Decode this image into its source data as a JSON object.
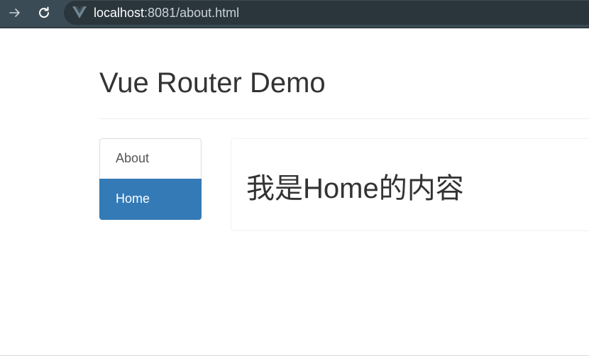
{
  "browser": {
    "url_host": "localhost",
    "url_rest": ":8081/about.html",
    "forward_icon": "forward-arrow-icon",
    "reload_icon": "reload-icon",
    "site_icon": "vue-logo-icon"
  },
  "header": {
    "title": "Vue Router Demo"
  },
  "nav": {
    "items": [
      {
        "label": "About",
        "active": false
      },
      {
        "label": "Home",
        "active": true
      }
    ],
    "active_color": "#337ab7"
  },
  "content": {
    "text": "我是Home的内容"
  }
}
